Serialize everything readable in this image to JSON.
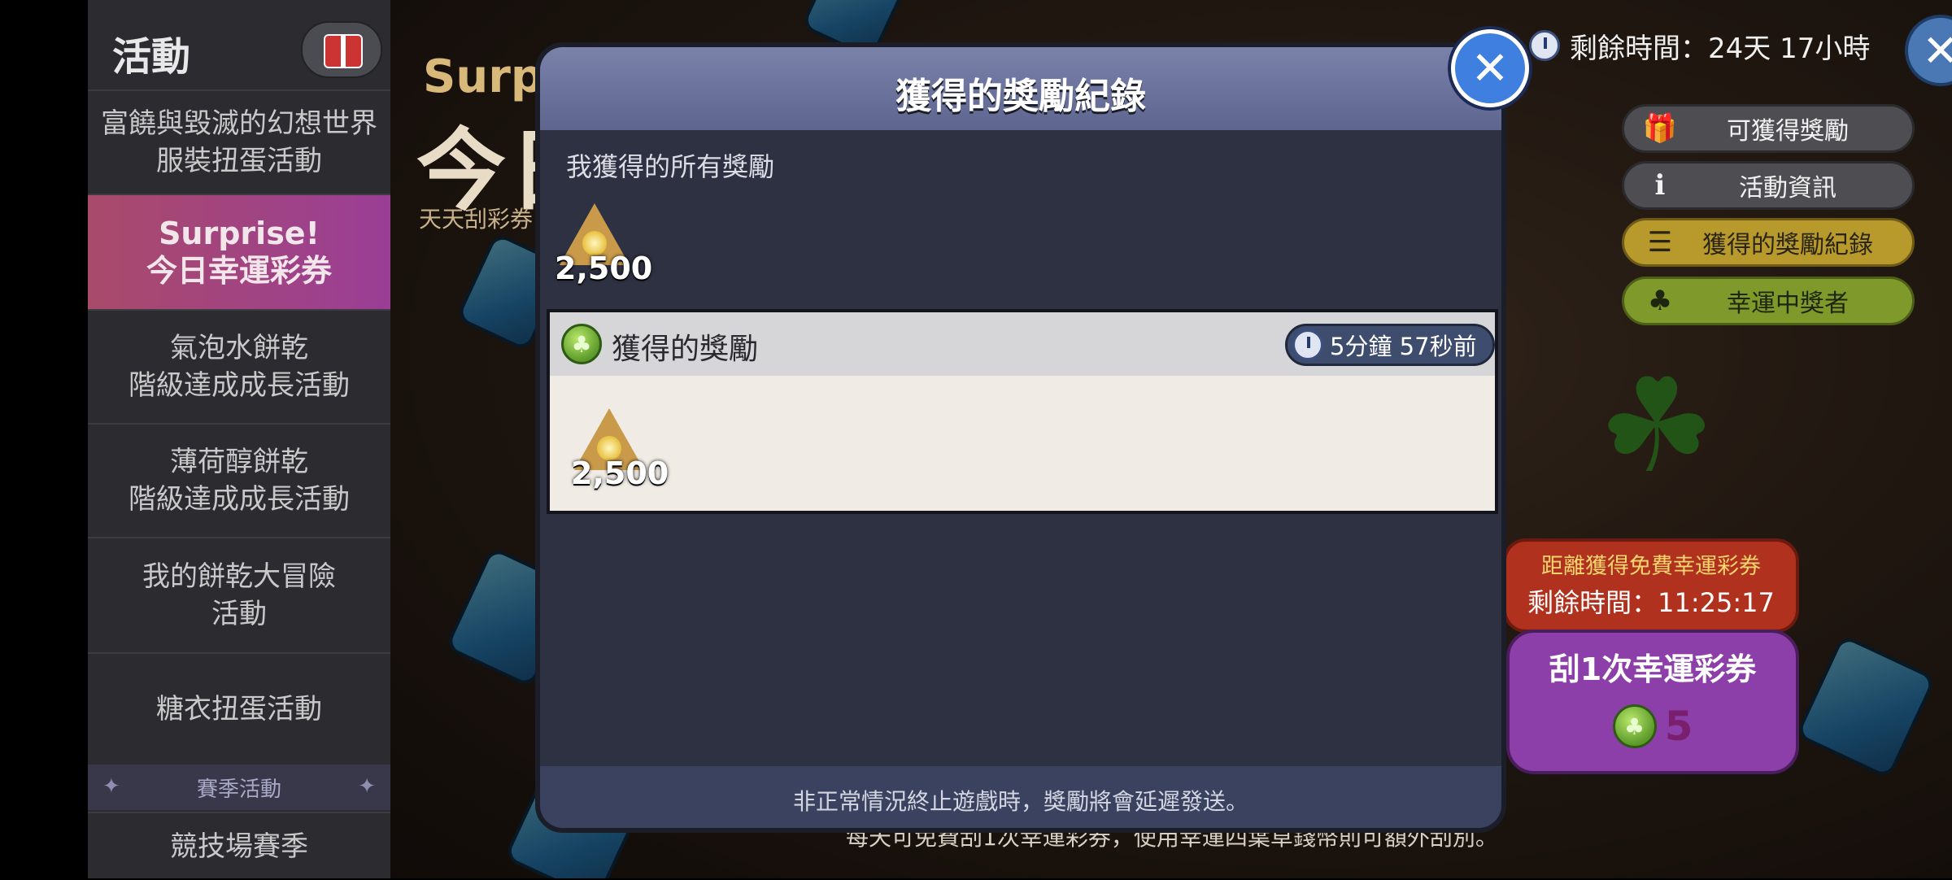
{
  "sidebar": {
    "title": "活動",
    "items": [
      {
        "label": "富饒與毀滅的幻想世界\n服裝扭蛋活動",
        "active": false
      },
      {
        "label": "Surprise!\n今日幸運彩券",
        "active": true
      },
      {
        "label": "氣泡水餅乾\n階級達成成長活動",
        "active": false
      },
      {
        "label": "薄荷醇餅乾\n階級達成成長活動",
        "active": false
      },
      {
        "label": "我的餅乾大冒險\n活動",
        "active": false
      },
      {
        "label": "糖衣扭蛋活動",
        "active": false
      }
    ],
    "season_header": "賽季活動",
    "season_item": "競技場賽季"
  },
  "background": {
    "title_en": "Surpri",
    "title_zh": "今日",
    "subtitle": "天天刮彩券",
    "footer": "每天可免費刮1次幸運彩券，使用幸運四葉草錢幣則可額外刮別。"
  },
  "hud": {
    "remaining_time": "剩餘時間：24天 17小時",
    "menu": [
      {
        "label": "可獲得獎勵",
        "icon": "gift-icon"
      },
      {
        "label": "活動資訊",
        "icon": "info-icon"
      },
      {
        "label": "獲得的獎勵紀錄",
        "icon": "list-icon"
      },
      {
        "label": "幸運中獎者",
        "icon": "clover-icon"
      }
    ]
  },
  "scratch": {
    "free_label": "距離獲得免費幸運彩券",
    "free_timer": "剩餘時間：11:25:17",
    "button_label": "刮1次幸運彩券",
    "cost": "5"
  },
  "modal": {
    "title": "獲得的獎勵紀錄",
    "all_rewards_label": "我獲得的所有獎勵",
    "total_amount": "2,500",
    "record": {
      "title": "獲得的獎勵",
      "time": "5分鐘 57秒前",
      "amount": "2,500"
    },
    "note": "非正常情況終止遊戲時，獎勵將會延遲發送。"
  },
  "colors": {
    "modal_header": "#6a73a0",
    "active_tab": "#a34a7e",
    "gold_pill": "#b89a2c",
    "green_pill": "#7f9a2a"
  }
}
